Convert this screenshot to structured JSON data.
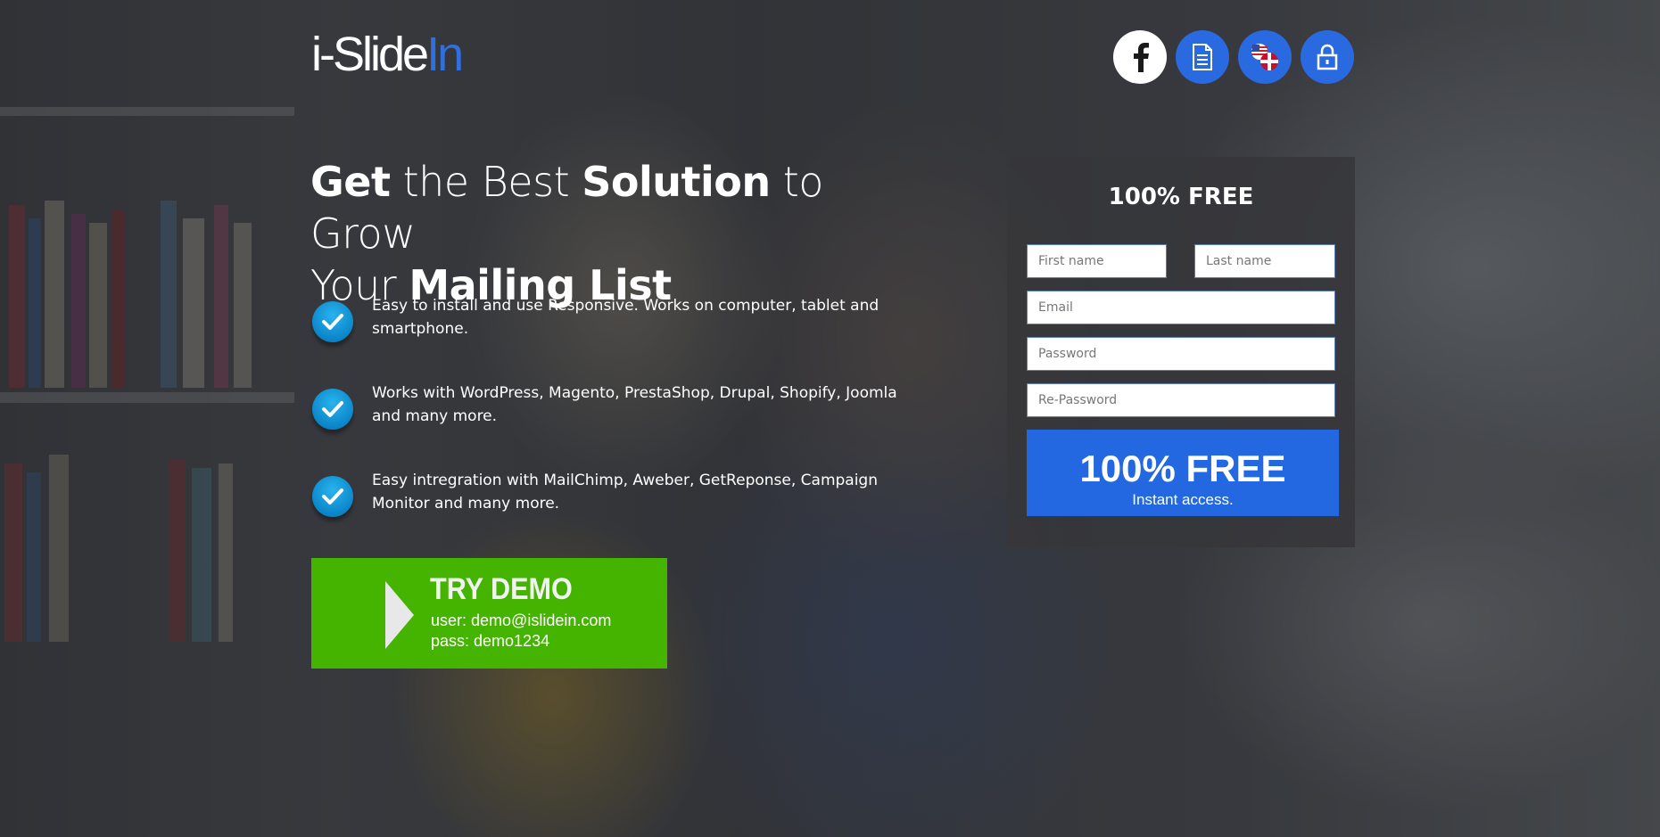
{
  "logo": {
    "prefix": "i-Slide",
    "accent": "In"
  },
  "header_icons": [
    "facebook-icon",
    "document-icon",
    "language-flags-icon",
    "lock-icon"
  ],
  "headline": {
    "w1": "Get",
    "w2": " the Best ",
    "w3": "Solution",
    "w4": " to Grow",
    "w5": "Your ",
    "w6": "Mailing List"
  },
  "features": [
    {
      "text": "Easy to install and use Responsive. Works on computer, tablet and smartphone."
    },
    {
      "text": "Works with WordPress, Magento, PrestaShop, Drupal, Shopify, Joomla and many more."
    },
    {
      "text": "Easy intregration with MailChimp, Aweber, GetReponse, Campaign Monitor and many more."
    }
  ],
  "demo": {
    "title": "TRY DEMO",
    "user": "user: demo@islidein.com",
    "pass": "pass: demo1234"
  },
  "form": {
    "title": "100% FREE",
    "first_name_placeholder": "First name",
    "last_name_placeholder": "Last name",
    "email_placeholder": "Email",
    "password_placeholder": "Password",
    "repassword_placeholder": "Re-Password",
    "submit_title": "100% FREE",
    "submit_sub": "Instant access."
  },
  "colors": {
    "accent_blue": "#2a6ae0",
    "demo_green": "#44b400",
    "check_blue": "#0b86c9"
  }
}
